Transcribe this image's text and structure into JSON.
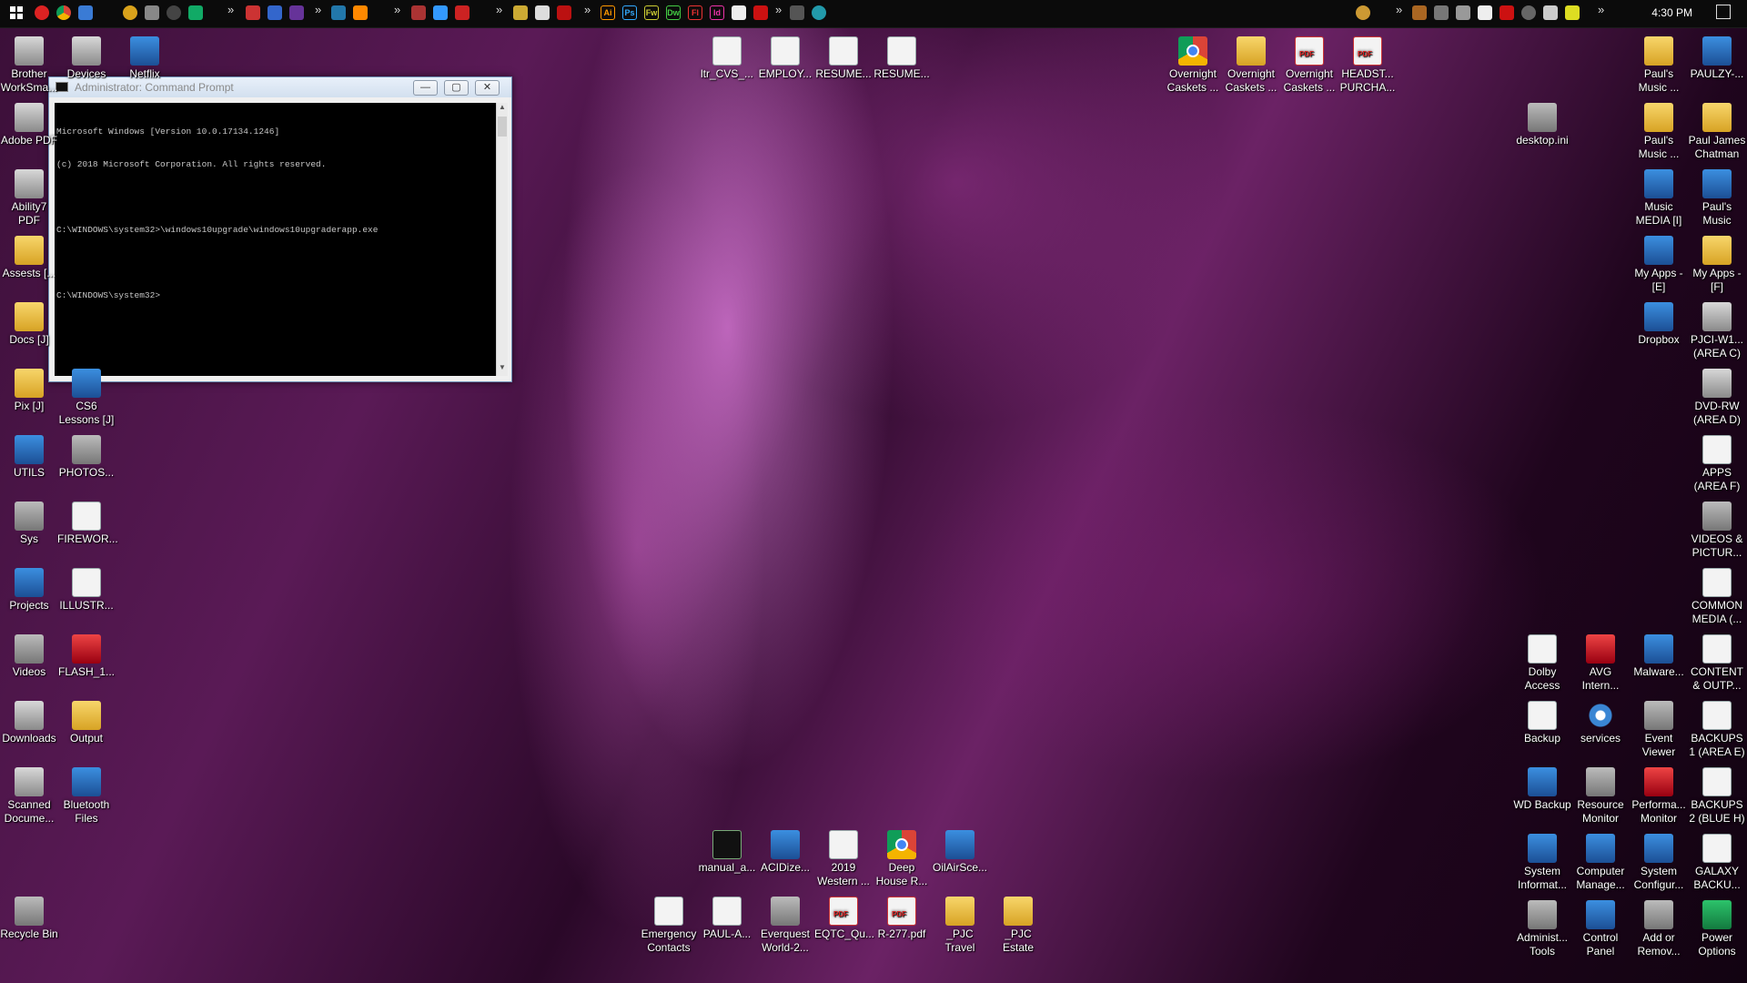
{
  "taskbar": {
    "start_icon": "windows-start-icon",
    "chevron": "»",
    "clock": "4:30 PM",
    "notification_icon": "notification-icon"
  },
  "cmd_window": {
    "title": "Administrator: Command Prompt",
    "minimize": "—",
    "maximize": "▢",
    "close": "✕",
    "lines": [
      "Microsoft Windows [Version 10.0.17134.1246]",
      "(c) 2018 Microsoft Corporation. All rights reserved.",
      "",
      "C:\\WINDOWS\\system32>\\windows10upgrade\\windows10upgraderapp.exe",
      "",
      "C:\\WINDOWS\\system32>"
    ]
  },
  "desktop": {
    "left_col1": [
      "Brother WorkSma...",
      "Adobe PDF",
      "Ability7 PDF",
      "Assests [...",
      "Docs [J]",
      "Pix [J]",
      "UTILS",
      "Sys",
      "Projects",
      "Videos",
      "Downloads",
      "Scanned Docume...",
      "Recycle Bin"
    ],
    "left_col2": [
      "Devices",
      "CS6 Lessons [J]",
      "PHOTOS...",
      "FIREWOR...",
      "ILLUSTR...",
      "FLASH_1...",
      "Output",
      "Bluetooth Files"
    ],
    "netflix": "Netflix",
    "top_docs": [
      "ltr_CVS_...",
      "EMPLOY...",
      "RESUME...",
      "RESUME..."
    ],
    "top_right_files": [
      "Overnight Caskets ...",
      "Overnight Caskets ...",
      "Overnight Caskets ...",
      "HEADST... PURCHA..."
    ],
    "desktop_ini": "desktop.ini",
    "right_col2": [
      "Paul's Music ...",
      "Paul's Music ...",
      "Music MEDIA [I]",
      "My Apps - [E]",
      "Dropbox",
      "Malware...",
      "Event Viewer",
      "Performa... Monitor",
      "System Configur...",
      "Add or Remov..."
    ],
    "right_col1": [
      "PAULZY-...",
      "Paul James Chatman",
      "Paul's Music",
      "My Apps - [F]",
      "PJCI-W1... (AREA C)",
      "DVD-RW (AREA D)",
      "APPS (AREA F)",
      "VIDEOS & PICTUR...",
      "COMMON MEDIA (...",
      "CONTENT & OUTP...",
      "BACKUPS 1 (AREA E)",
      "BACKUPS 2 (BLUE H)",
      "GALAXY BACKU...",
      "Power Options"
    ],
    "right_col4": [
      "Dolby Access",
      "Backup",
      "WD Backup",
      "System Informat...",
      "Administ... Tools"
    ],
    "right_col3": [
      "AVG Intern...",
      "services",
      "Resource Monitor",
      "Computer Manage...",
      "Control Panel"
    ],
    "bottom_row1": [
      "manual_a...",
      "ACIDize...",
      "2019 Western ...",
      "Deep House R...",
      "OilAirSce..."
    ],
    "bottom_row2": [
      "Emergency Contacts",
      "PAUL-A...",
      "Everquest World-2...",
      "EQTC_Qu...",
      "R-277.pdf",
      "_PJC Travel",
      "_PJC Estate"
    ]
  }
}
